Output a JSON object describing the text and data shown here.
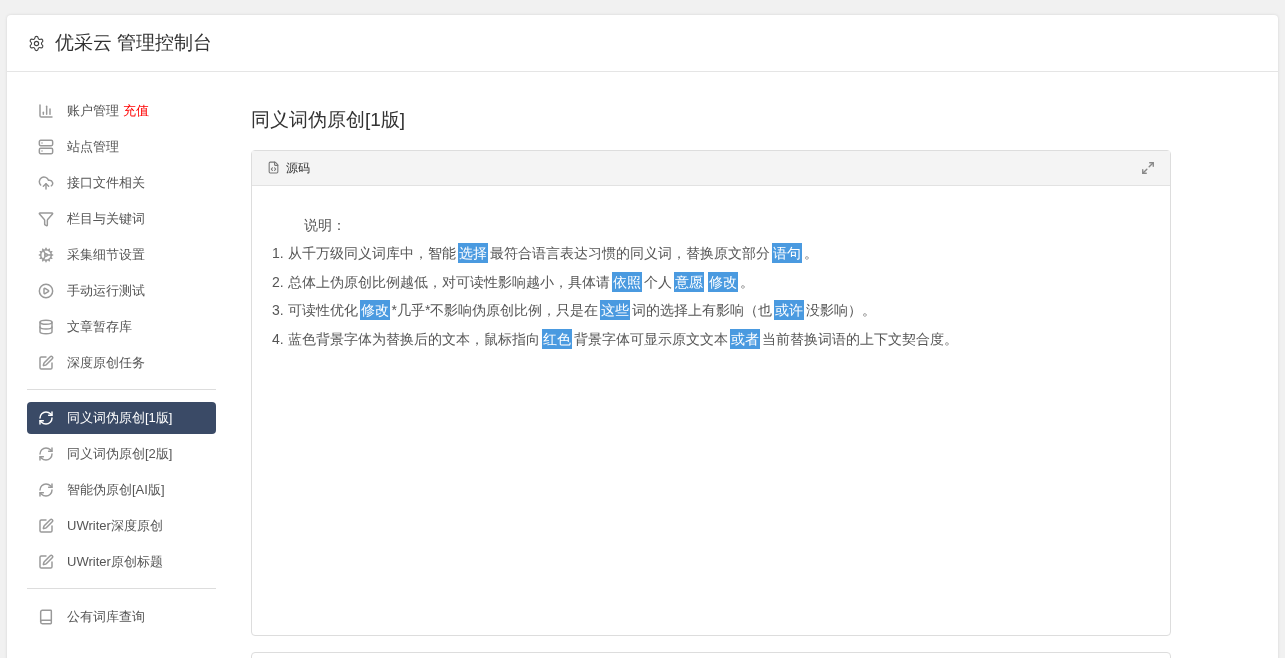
{
  "header": {
    "title": "优采云 管理控制台"
  },
  "sidebar": {
    "groups": [
      {
        "items": [
          {
            "label": "账户管理",
            "badge": "充值",
            "selected": false
          },
          {
            "label": "站点管理",
            "selected": false
          },
          {
            "label": "接口文件相关",
            "selected": false
          },
          {
            "label": "栏目与关键词",
            "selected": false
          },
          {
            "label": "采集细节设置",
            "selected": false
          },
          {
            "label": "手动运行测试",
            "selected": false
          },
          {
            "label": "文章暂存库",
            "selected": false
          },
          {
            "label": "深度原创任务",
            "selected": false
          }
        ]
      },
      {
        "items": [
          {
            "label": "同义词伪原创[1版]",
            "selected": true
          },
          {
            "label": "同义词伪原创[2版]",
            "selected": false
          },
          {
            "label": "智能伪原创[AI版]",
            "selected": false
          },
          {
            "label": "UWriter深度原创",
            "selected": false
          },
          {
            "label": "UWriter原创标题",
            "selected": false
          }
        ]
      },
      {
        "items": [
          {
            "label": "公有词库查询",
            "selected": false
          }
        ]
      }
    ]
  },
  "main": {
    "title": "同义词伪原创[1版]",
    "panel": {
      "tab": "源码",
      "heading": "说明：",
      "lines": [
        [
          {
            "text": "1. 从千万级同义词库中，智能",
            "replaced": false
          },
          {
            "text": "选择",
            "replaced": true
          },
          {
            "text": "最符合语言表达习惯的同义词，替换原文部分",
            "replaced": false
          },
          {
            "text": "语句",
            "replaced": true
          },
          {
            "text": "。",
            "replaced": false
          }
        ],
        [
          {
            "text": "2. 总体上伪原创比例越低，对可读性影响越小，具体请",
            "replaced": false
          },
          {
            "text": "依照",
            "replaced": true
          },
          {
            "text": "个人",
            "replaced": false
          },
          {
            "text": "意愿",
            "replaced": true
          },
          {
            "text": "修改",
            "replaced": true
          },
          {
            "text": "。",
            "replaced": false
          }
        ],
        [
          {
            "text": "3. 可读性优化",
            "replaced": false
          },
          {
            "text": "修改",
            "replaced": true
          },
          {
            "text": "*几乎*不影响伪原创比例，只是在",
            "replaced": false
          },
          {
            "text": "这些",
            "replaced": true
          },
          {
            "text": "词的选择上有影响（也",
            "replaced": false
          },
          {
            "text": "或许",
            "replaced": true
          },
          {
            "text": "没影响）。",
            "replaced": false
          }
        ],
        [
          {
            "text": "4. 蓝色背景字体为替换后的文本，鼠标指向",
            "replaced": false
          },
          {
            "text": "红色",
            "replaced": true
          },
          {
            "text": "背景字体可显示原文文本",
            "replaced": false
          },
          {
            "text": "或者",
            "replaced": true
          },
          {
            "text": "当前替换词语的上下文契合度。",
            "replaced": false
          }
        ]
      ]
    }
  }
}
